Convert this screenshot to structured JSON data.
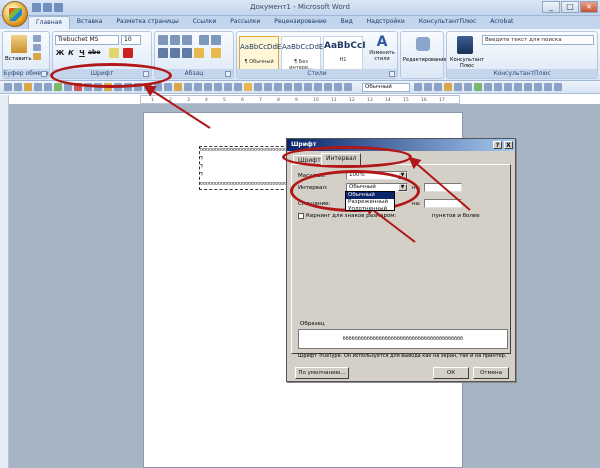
{
  "titlebar": {
    "title": "Документ1 - Microsoft Word"
  },
  "tabs": [
    {
      "label": "Главная",
      "active": true
    },
    {
      "label": "Вставка"
    },
    {
      "label": "Разметка страницы"
    },
    {
      "label": "Ссылки"
    },
    {
      "label": "Рассылки"
    },
    {
      "label": "Рецензирование"
    },
    {
      "label": "Вид"
    },
    {
      "label": "Надстройки"
    },
    {
      "label": "КонсультантПлюс"
    },
    {
      "label": "Acrobat"
    }
  ],
  "ribbon": {
    "clipboard": {
      "label": "Буфер обмена",
      "paste_label": "Вставить"
    },
    "font": {
      "label": "Шрифт",
      "font_name": "Trebuchet MS",
      "font_size": "10"
    },
    "paragraph": {
      "label": "Абзац"
    },
    "styles": {
      "label": "Стили",
      "items": [
        {
          "sample": "AaBbCcDdEe",
          "name": "¶ Обычный"
        },
        {
          "sample": "AaBbCcDdEe",
          "name": "¶ Без интерв..."
        },
        {
          "sample": "AaBbCcI",
          "name": "Н1"
        }
      ],
      "change_styles_label": "Изменить стили"
    },
    "editing": {
      "label": "Редактирование"
    },
    "consultant": {
      "label": "КонсультантПлюс",
      "button_label": "Консультант Плюс"
    },
    "help_search": {
      "placeholder": "Введите текст для поиска"
    }
  },
  "toolbar2": {
    "style_combo": "Обычный"
  },
  "ruler": {
    "ticks": [
      "1",
      "2",
      "3",
      "4",
      "5",
      "6",
      "7",
      "8",
      "9",
      "10",
      "11",
      "12",
      "13",
      "14",
      "15",
      "16",
      "17"
    ]
  },
  "document": {
    "lines": [
      "бббббббббббббббббббббббббббббббббббббббббб",
      "¶",
      "¶",
      "¶",
      "бббббббббббббббббббббббббббббббббббббббббб"
    ]
  },
  "dialog": {
    "title": "Шрифт",
    "help_btn": "?",
    "close_btn": "X",
    "tabs": [
      {
        "label": "Шрифт"
      },
      {
        "label": "Интервал",
        "active": true
      }
    ],
    "scale_label": "Масштаб:",
    "scale_value": "100%",
    "spacing_label": "Интервал:",
    "spacing_value": "Обычный",
    "spacing_by_label": "на:",
    "spacing_options": [
      "Обычный",
      "Разреженный",
      "Уплотненный"
    ],
    "offset_label": "Смещение:",
    "offset_by_label": "на:",
    "kerning_label": "Кернинг для знаков размером:",
    "kerning_suffix": "пунктов и более",
    "preview_label": "Образец",
    "preview_text": "бббббббббббббббббббббббббббббббббббббббб",
    "truetype_note": "Шрифт TrueType. Он используется для вывода как на экран, так и на принтер.",
    "default_btn": "По умолчанию...",
    "ok_btn": "ОК",
    "cancel_btn": "Отмена"
  },
  "colors": {
    "annotation_red": "#b01818",
    "ribbon_blue": "#c3d5ec",
    "dialog_title": "#0a246a"
  }
}
